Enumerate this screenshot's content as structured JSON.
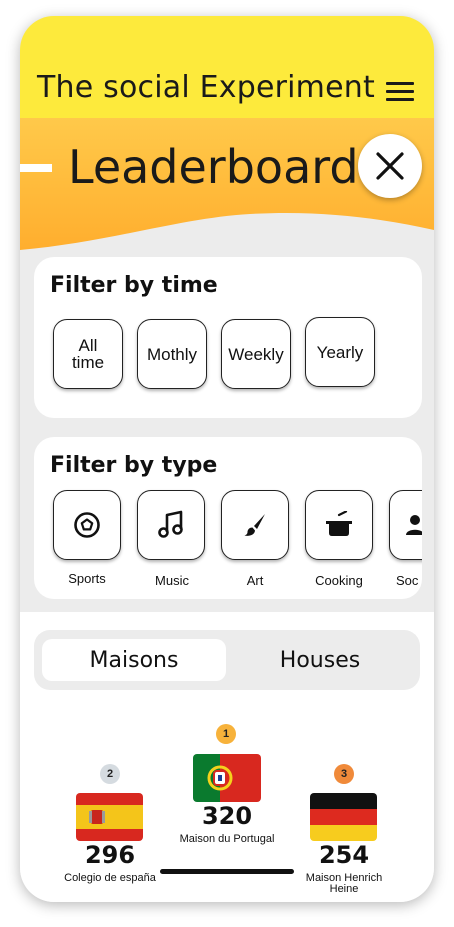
{
  "header": {
    "app_title": "The social Experiment",
    "menu_icon": "hamburger-menu-icon"
  },
  "hero": {
    "title": "Leaderboard",
    "close_icon": "close-icon",
    "colors": {
      "top": "#ffc94a",
      "bottom": "#ffb12e",
      "bar": "#fdea3c"
    }
  },
  "filter_time": {
    "title": "Filter by time",
    "options": [
      {
        "label": "All time"
      },
      {
        "label": "Mothly"
      },
      {
        "label": "Weekly"
      },
      {
        "label": "Yearly"
      }
    ]
  },
  "filter_type": {
    "title": "Filter by type",
    "options": [
      {
        "label": "Sports",
        "icon": "soccer-ball-icon"
      },
      {
        "label": "Music",
        "icon": "music-note-icon"
      },
      {
        "label": "Art",
        "icon": "paintbrush-icon"
      },
      {
        "label": "Cooking",
        "icon": "cooking-pot-icon"
      },
      {
        "label": "Soc",
        "icon": "people-icon"
      }
    ]
  },
  "segment": {
    "options": [
      "Maisons",
      "Houses"
    ],
    "selected": "Maisons"
  },
  "podium": [
    {
      "rank": "1",
      "score": "320",
      "name": "Maison du Portugal",
      "flag": "portugal-flag",
      "badge_color": "#f7b23b"
    },
    {
      "rank": "2",
      "score": "296",
      "name": "Colegio de españa",
      "flag": "spain-flag",
      "badge_color": "#d5dbe0"
    },
    {
      "rank": "3",
      "score": "254",
      "name": "Maison Henrich Heine",
      "flag": "germany-flag",
      "badge_color": "#f08a3a"
    }
  ]
}
